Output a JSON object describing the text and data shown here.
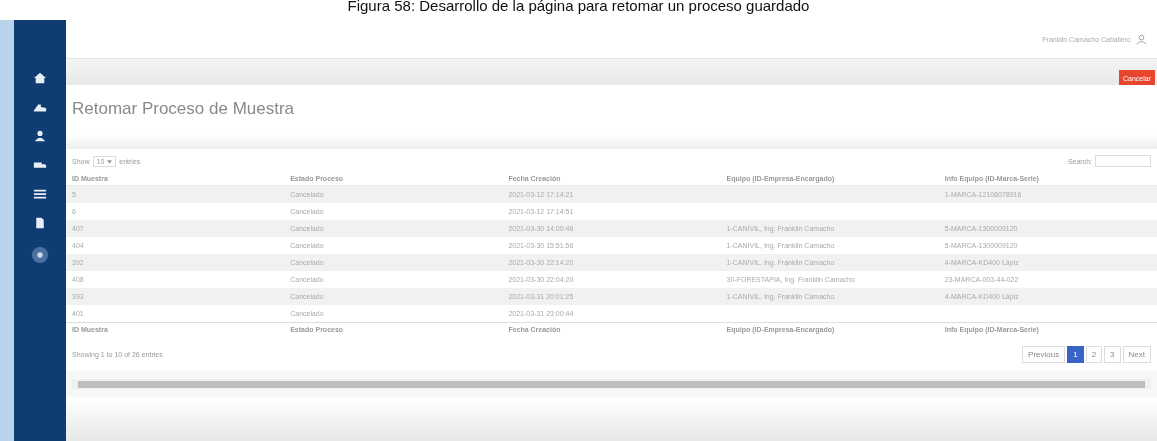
{
  "caption": "Figura 58: Desarrollo de la página para retomar un proceso guardado",
  "header": {
    "user": "Franklin Camacho Caballero"
  },
  "toolbar": {
    "cancel_button": "Cancelar"
  },
  "page_title": "Retomar Proceso de Muestra",
  "table_controls": {
    "show_label": "Show",
    "page_size": "10",
    "entries_label": "entries",
    "search_label": "Search:"
  },
  "table": {
    "columns": [
      "ID Muestra",
      "Estado Proceso",
      "Fecha Creación",
      "Equipo (ID-Empresa-Encargado)",
      "Info Equipo (ID-Marca-Serie)"
    ],
    "rows": [
      [
        "5",
        "Cancelado",
        "2021-03-12 17:14:21",
        "",
        "1-MARCA-12106078916"
      ],
      [
        "6",
        "Cancelado",
        "2021-03-12 17:14:51",
        "",
        ""
      ],
      [
        "407",
        "Cancelado",
        "2021-03-30 14:00:46",
        "1-CANIVIL, Ing. Franklin Camacho",
        "5-MARCA-1300009120"
      ],
      [
        "404",
        "Cancelado",
        "2021-03-30 15:51:56",
        "1-CANIVIL, Ing. Franklin Camacho",
        "5-MARCA-1300009120"
      ],
      [
        "392",
        "Cancelado",
        "2021-03-30 22:14:20",
        "1-CANIVIL, Ing. Franklin Camacho",
        "4-MARCA-KD400 Lápiz"
      ],
      [
        "408",
        "Cancelado",
        "2021-03-30 22:04:20",
        "30-FORESTAPIA, Ing. Franklin Camacho",
        "23-MARCA-003-44-022"
      ],
      [
        "393",
        "Cancelado",
        "2021-03-31 20:01:25",
        "1-CANIVIL, Ing. Franklin Camacho",
        "4-MARCA-KD400 Lápiz"
      ],
      [
        "401",
        "Cancelado",
        "2021-03-31 23:00:44",
        "",
        ""
      ]
    ],
    "footer_columns": [
      "ID Muestra",
      "Estado Proceso",
      "Fecha Creación",
      "Equipo (ID-Empresa-Encargado)",
      "Info Equipo (ID-Marca-Serie)"
    ]
  },
  "info": "Showing 1 to 10 of 26 entries",
  "pagination": [
    {
      "label": "Previous",
      "selected": false
    },
    {
      "label": "1",
      "selected": true
    },
    {
      "label": "2",
      "selected": false
    },
    {
      "label": "3",
      "selected": false
    },
    {
      "label": "Next",
      "selected": false
    }
  ]
}
